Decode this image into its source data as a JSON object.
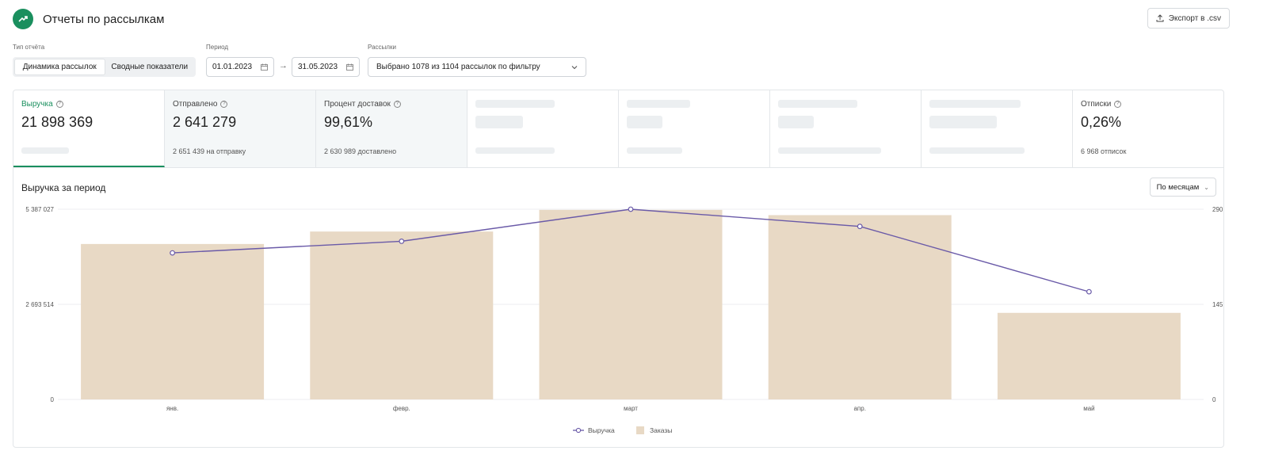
{
  "header": {
    "title": "Отчеты по рассылкам",
    "export_label": "Экспорт в .csv"
  },
  "filters": {
    "report_type_label": "Тип отчёта",
    "report_type_options": [
      "Динамика рассылок",
      "Сводные показатели"
    ],
    "period_label": "Период",
    "date_from": "01.01.2023",
    "date_to": "31.05.2023",
    "mailings_label": "Рассылки",
    "mailings_selected": "Выбрано 1078 из 1104 рассылок по фильтру"
  },
  "metrics": [
    {
      "label": "Выручка",
      "value": "21 898 369",
      "sub": ""
    },
    {
      "label": "Отправлено",
      "value": "2 641 279",
      "sub": "2 651 439 на отправку"
    },
    {
      "label": "Процент доставок",
      "value": "99,61%",
      "sub": "2 630 989 доставлено"
    },
    {
      "label": "",
      "value": "",
      "sub": ""
    },
    {
      "label": "",
      "value": "",
      "sub": ""
    },
    {
      "label": "",
      "value": "",
      "sub": ""
    },
    {
      "label": "",
      "value": "",
      "sub": ""
    },
    {
      "label": "Отписки",
      "value": "0,26%",
      "sub": "6 968 отписок"
    }
  ],
  "chart": {
    "title": "Выручка за период",
    "period_select": "По месяцам"
  },
  "chart_data": {
    "type": "bar",
    "categories": [
      "янв.",
      "февр.",
      "март",
      "апр.",
      "май"
    ],
    "series": [
      {
        "name": "Заказы",
        "type": "bar",
        "axis": "right",
        "values": [
          237,
          256,
          289,
          281,
          132
        ],
        "color": "#e8d9c5"
      },
      {
        "name": "Выручка",
        "type": "line",
        "axis": "left",
        "values": [
          4150000,
          4480000,
          5387027,
          4900000,
          3050000
        ],
        "color": "#6a5aa8"
      }
    ],
    "left_ticks": [
      "5 387 027",
      "2 693 514",
      "0"
    ],
    "left_ylim": [
      0,
      5387027
    ],
    "right_ticks": [
      "290",
      "145",
      "0"
    ],
    "right_ylim": [
      0,
      290
    ],
    "grid": true,
    "legend_position": "bottom"
  }
}
